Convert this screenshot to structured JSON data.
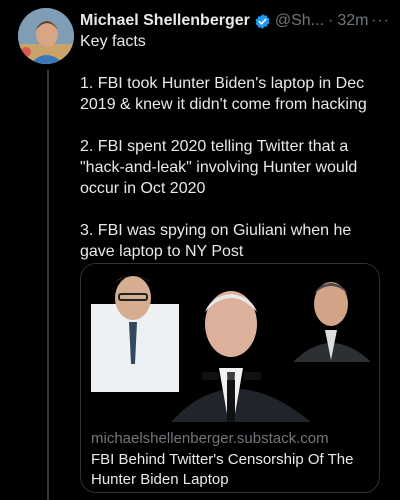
{
  "tweet": {
    "author_name": "Michael Shellenberger",
    "handle": "@Sh...",
    "separator": "·",
    "time": "32m",
    "more": "···",
    "icons": {
      "verified": "verified-badge-icon",
      "more": "more-options-icon"
    },
    "paragraphs": [
      "Key facts",
      "1. FBI took Hunter Biden's laptop in Dec 2019 & knew it didn't come from hacking",
      "2. FBI spent 2020 telling Twitter that a \"hack-and-leak\" involving Hunter would occur in Oct 2020",
      "3. FBI was spying on Giuliani when he gave laptop to NY Post"
    ]
  },
  "link_card": {
    "domain": "michaelshellenberger.substack.com",
    "title": "FBI Behind Twitter's Censorship Of The Hunter Biden Laptop"
  },
  "colors": {
    "background": "#000000",
    "text": "#e7e9ea",
    "secondary": "#71767b",
    "verified": "#1d9bf0",
    "border": "#2f3336"
  }
}
